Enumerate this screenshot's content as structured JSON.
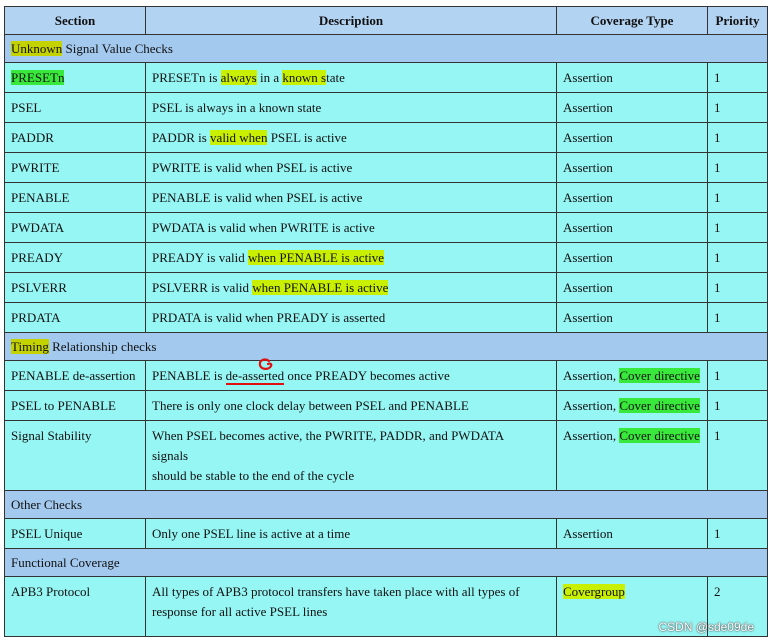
{
  "headers": {
    "section": "Section",
    "description": "Description",
    "coverage": "Coverage Type",
    "priority": "Priority"
  },
  "groups": {
    "unknown": {
      "word": "Unknown",
      "rest": " Signal Value Checks"
    },
    "timing": {
      "word": "Timing",
      "rest": " Relationship checks"
    },
    "other": "Other Checks",
    "functional": "Functional Coverage"
  },
  "rows": {
    "presetn": {
      "section": "PRESETn",
      "desc": [
        "PRESETn is ",
        "always",
        " in a ",
        "known s",
        "tate"
      ],
      "coverage": "Assertion",
      "priority": "1"
    },
    "psel": {
      "section": "PSEL",
      "desc": "PSEL is always in a known state",
      "coverage": "Assertion",
      "priority": "1"
    },
    "paddr": {
      "section": "PADDR",
      "desc": [
        "PADDR is ",
        "valid when",
        " PSEL is active"
      ],
      "coverage": "Assertion",
      "priority": "1"
    },
    "pwrite": {
      "section": "PWRITE",
      "desc": "PWRITE is valid when PSEL is active",
      "coverage": "Assertion",
      "priority": "1"
    },
    "penable": {
      "section": "PENABLE",
      "desc": "PENABLE is valid when PSEL is active",
      "coverage": "Assertion",
      "priority": "1"
    },
    "pwdata": {
      "section": "PWDATA",
      "desc": "PWDATA is valid when PWRITE is active",
      "coverage": "Assertion",
      "priority": "1"
    },
    "pready": {
      "section": "PREADY",
      "desc": [
        "PREADY is valid ",
        "when PENABLE is active"
      ],
      "coverage": "Assertion",
      "priority": "1"
    },
    "pslverr": {
      "section": "PSLVERR",
      "desc": [
        "PSLVERR is valid ",
        "when PENABLE is active"
      ],
      "coverage": "Assertion",
      "priority": "1"
    },
    "prdata": {
      "section": "PRDATA",
      "desc": "PRDATA is valid when PREADY is asserted",
      "coverage": "Assertion",
      "priority": "1"
    },
    "penable_deassert": {
      "section": "PENABLE de-assertion",
      "desc": [
        "PENABLE is ",
        "de-asserted",
        " once PREADY becomes active"
      ],
      "coverage": [
        "Assertion, ",
        "Cover directive"
      ],
      "priority": "1"
    },
    "psel_to_penable": {
      "section": "PSEL to PENABLE",
      "desc": "There is only one clock delay between PSEL and PENABLE",
      "coverage": [
        "Assertion, ",
        "Cover directive"
      ],
      "priority": "1"
    },
    "signal_stability": {
      "section": "Signal Stability",
      "desc": [
        "When PSEL becomes active, the PWRITE, PADDR, and PWDATA",
        "signals",
        "should be stable to the end of the cycle"
      ],
      "coverage": [
        "Assertion, ",
        "Cover directive"
      ],
      "priority": "1"
    },
    "psel_unique": {
      "section": "PSEL Unique",
      "desc": "Only one PSEL line is active at a time",
      "coverage": "Assertion",
      "priority": "1"
    },
    "apb3_protocol": {
      "section": "APB3 Protocol",
      "desc": [
        "All types of APB3 protocol transfers have taken place with all types of",
        "response for all active PSEL lines"
      ],
      "coverage": "Covergroup",
      "priority": "2"
    }
  },
  "colors": {
    "header_bg": "#b3d3f2",
    "group_bg": "#a3c9ef",
    "row_bg": "#96f6f4",
    "highlight_yellow_green": "#c8f000",
    "highlight_green": "#38e83a",
    "annotation_red": "#e01010"
  },
  "watermark": "CSDN @sde09de"
}
